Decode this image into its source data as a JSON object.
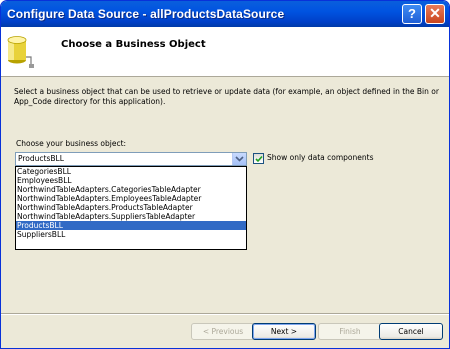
{
  "window": {
    "title": "Configure Data Source - allProductsDataSource",
    "help_glyph": "?",
    "close_glyph": "✕"
  },
  "header": {
    "title": "Choose a Business Object",
    "icon": "database-icon"
  },
  "description": "Select a business object that can be used to retrieve or update data (for example, an object defined in the Bin or App_Code directory for this application).",
  "business_object": {
    "label": "Choose your business object:",
    "selected_value": "ProductsBLL",
    "options": [
      "CategoriesBLL",
      "EmployeesBLL",
      "NorthwindTableAdapters.CategoriesTableAdapter",
      "NorthwindTableAdapters.EmployeesTableAdapter",
      "NorthwindTableAdapters.ProductsTableAdapter",
      "NorthwindTableAdapters.SuppliersTableAdapter",
      "ProductsBLL",
      "SuppliersBLL"
    ],
    "highlighted_index": 6
  },
  "show_only_data_components": {
    "label": "Show only data components",
    "checked": true
  },
  "buttons": {
    "previous": "< Previous",
    "next": "Next >",
    "finish": "Finish",
    "cancel": "Cancel"
  },
  "colors": {
    "titlebar": "#0053e1",
    "selection": "#316ac5",
    "dialog_bg": "#ece9d8"
  }
}
